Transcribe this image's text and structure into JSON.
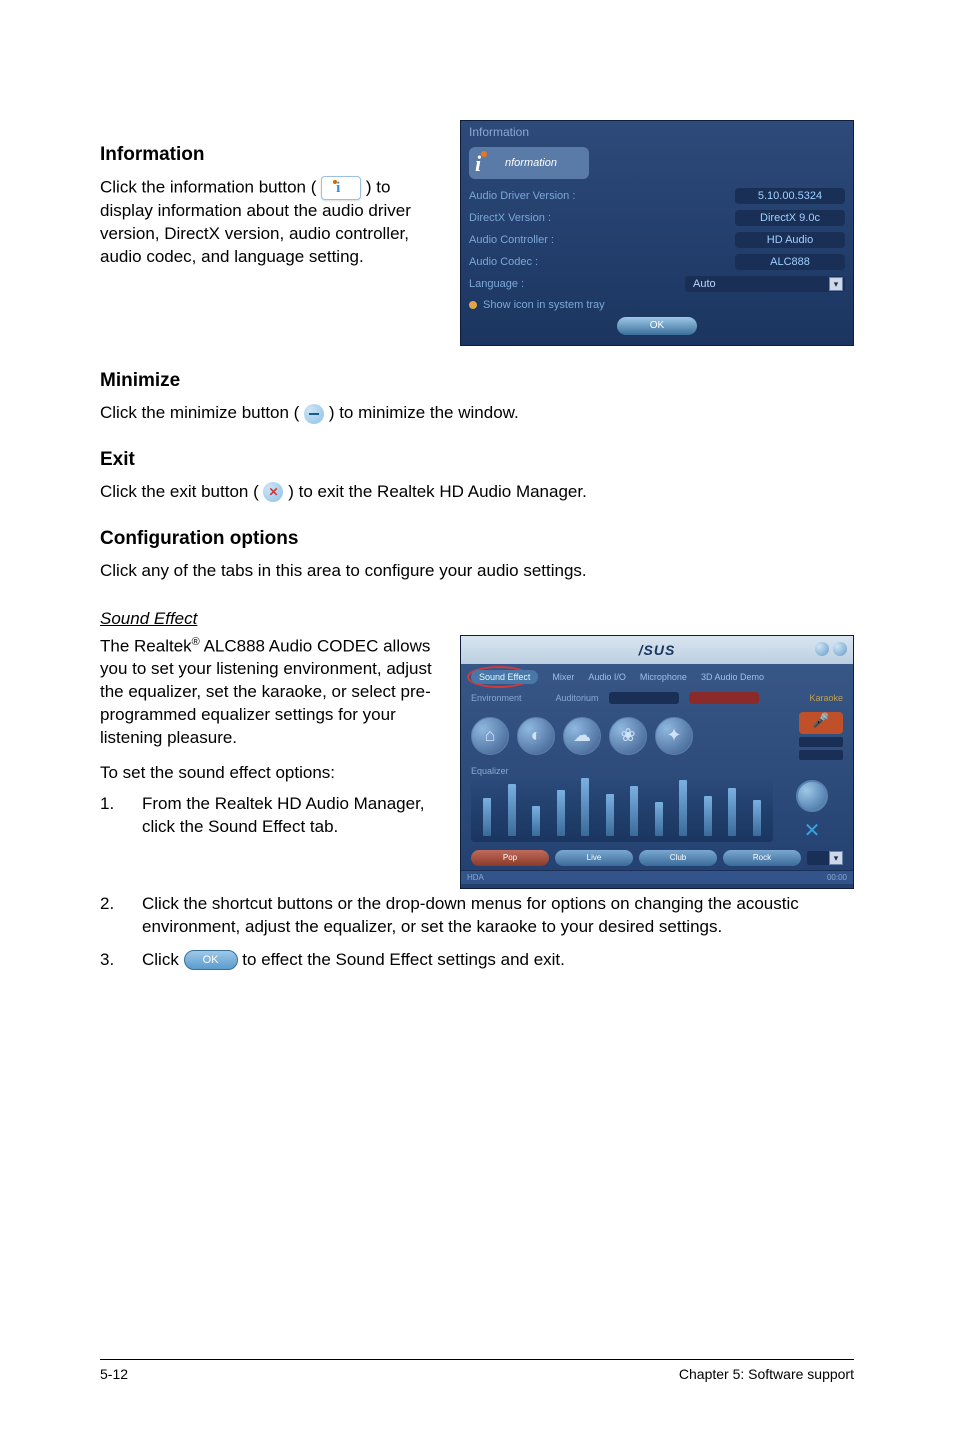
{
  "headings": {
    "information": "Information",
    "minimize": "Minimize",
    "exit": "Exit",
    "config": "Configuration options"
  },
  "paragraphs": {
    "info_pre": "Click the information button ( ",
    "info_post": " ) to display information about the audio driver version, DirectX version, audio controller, audio codec, and language setting.",
    "minimize_pre": "Click the minimize button (",
    "minimize_post": ") to minimize the window.",
    "exit_pre": "Click the exit button (",
    "exit_post": ") to exit the Realtek HD Audio Manager.",
    "config": "Click any of the tabs in this area to configure your audio settings.",
    "sound_effect_label": "Sound Effect ",
    "se_body_pre": "The Realtek",
    "se_body_sup": "®",
    "se_body_post": " ALC888 Audio CODEC allows you to set your listening environment, adjust the equalizer, set the karaoke, or select pre-programmed equalizer settings for your listening pleasure.",
    "se_to_set": "To set the sound effect options:"
  },
  "steps": {
    "s1_num": "1.",
    "s1_txt": "From the Realtek HD Audio Manager, click the Sound Effect tab.",
    "s2_num": "2.",
    "s2_txt": "Click the shortcut buttons or the drop-down menus for options on changing the acoustic environment, adjust the equalizer, or set the karaoke to your desired settings.",
    "s3_num": "3.",
    "s3_pre": "Click ",
    "s3_post": " to effect the Sound Effect settings and exit."
  },
  "info_panel": {
    "title": "Information",
    "card": "nformation",
    "rows": {
      "driver_label": "Audio Driver Version :",
      "driver_val": "5.10.00.5324",
      "dx_label": "DirectX Version :",
      "dx_val": "DirectX 9.0c",
      "ctrl_label": "Audio Controller :",
      "ctrl_val": "HD Audio",
      "codec_label": "Audio Codec :",
      "codec_val": "ALC888",
      "lang_label": "Language :",
      "lang_val": "Auto"
    },
    "checkbox": "Show icon in system tray",
    "ok": "OK"
  },
  "se_panel": {
    "brand": "/SUS",
    "tabs": {
      "active": "Sound Effect",
      "t2": "Mixer",
      "t3": "Audio I/O",
      "t4": "Microphone",
      "t5": "3D Audio Demo"
    },
    "sub": {
      "env": "Environment",
      "aud": "Auditorium",
      "kar": "Karaoke"
    },
    "eq_label": "Equalizer",
    "eq_heights": [
      38,
      52,
      30,
      46,
      58,
      42,
      50,
      34,
      56,
      40,
      48,
      36
    ],
    "presets": [
      "Pop",
      "Live",
      "Club",
      "Rock"
    ],
    "bottom_left": "HDA",
    "bottom_right": "00:00"
  },
  "ok_inline": "OK",
  "footer": {
    "left": "5-12",
    "right": "Chapter 5: Software support"
  }
}
